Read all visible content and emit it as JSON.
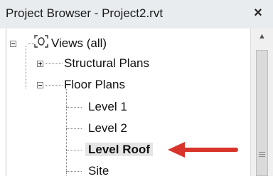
{
  "header": {
    "title": "Project Browser - Project2.rvt",
    "close_glyph": "×"
  },
  "tree": {
    "root": {
      "label": "Views (all)",
      "icon": "views-icon",
      "expanded": true
    },
    "items": [
      {
        "label": "Structural Plans",
        "expanded": false
      },
      {
        "label": "Floor Plans",
        "expanded": true,
        "children": [
          "Level 1",
          "Level 2",
          "Level Roof",
          "Site"
        ]
      }
    ],
    "selected": "Level Roof"
  },
  "annotation": {
    "arrow_color": "#d9342b",
    "points_to": "Level Roof"
  },
  "scrollbar": {
    "up_glyph": "▲"
  }
}
